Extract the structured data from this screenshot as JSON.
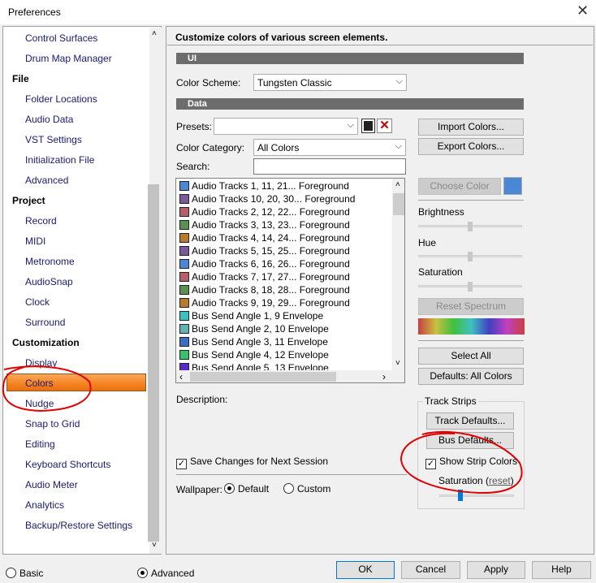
{
  "window": {
    "title": "Preferences",
    "close_icon": "close-icon"
  },
  "sidebar": {
    "items": [
      {
        "type": "item",
        "label": "Control Surfaces"
      },
      {
        "type": "item",
        "label": "Drum Map Manager"
      },
      {
        "type": "header",
        "label": "File"
      },
      {
        "type": "item",
        "label": "Folder Locations"
      },
      {
        "type": "item",
        "label": "Audio Data"
      },
      {
        "type": "item",
        "label": "VST Settings"
      },
      {
        "type": "item",
        "label": "Initialization File"
      },
      {
        "type": "item",
        "label": "Advanced"
      },
      {
        "type": "header",
        "label": "Project"
      },
      {
        "type": "item",
        "label": "Record"
      },
      {
        "type": "item",
        "label": "MIDI"
      },
      {
        "type": "item",
        "label": "Metronome"
      },
      {
        "type": "item",
        "label": "AudioSnap"
      },
      {
        "type": "item",
        "label": "Clock"
      },
      {
        "type": "item",
        "label": "Surround"
      },
      {
        "type": "header",
        "label": "Customization"
      },
      {
        "type": "item",
        "label": "Display"
      },
      {
        "type": "item",
        "label": "Colors",
        "selected": true
      },
      {
        "type": "item",
        "label": "Nudge"
      },
      {
        "type": "item",
        "label": "Snap to Grid"
      },
      {
        "type": "item",
        "label": "Editing"
      },
      {
        "type": "item",
        "label": "Keyboard Shortcuts"
      },
      {
        "type": "item",
        "label": "Audio Meter"
      },
      {
        "type": "item",
        "label": "Analytics"
      },
      {
        "type": "item",
        "label": "Backup/Restore Settings"
      }
    ]
  },
  "main": {
    "header": "Customize colors of various screen elements.",
    "ui_section": "UI",
    "color_scheme_label": "Color Scheme:",
    "color_scheme_value": "Tungsten Classic",
    "data_section": "Data",
    "presets_label": "Presets:",
    "presets_value": "",
    "color_category_label": "Color Category:",
    "color_category_value": "All Colors",
    "search_label": "Search:",
    "search_value": "",
    "list": [
      {
        "label": "Audio Tracks 1, 11, 21... Foreground",
        "color": "#4a88d6"
      },
      {
        "label": "Audio Tracks 10, 20, 30... Foreground",
        "color": "#7a5a9a"
      },
      {
        "label": "Audio Tracks 2, 12, 22... Foreground",
        "color": "#b85e6a"
      },
      {
        "label": "Audio Tracks 3, 13, 23... Foreground",
        "color": "#5a9050"
      },
      {
        "label": "Audio Tracks 4, 14, 24... Foreground",
        "color": "#b87a30"
      },
      {
        "label": "Audio Tracks 5, 15, 25... Foreground",
        "color": "#7a5a9a"
      },
      {
        "label": "Audio Tracks 6, 16, 26... Foreground",
        "color": "#4a88d6"
      },
      {
        "label": "Audio Tracks 7, 17, 27... Foreground",
        "color": "#b85e6a"
      },
      {
        "label": "Audio Tracks 8, 18, 28... Foreground",
        "color": "#5a9050"
      },
      {
        "label": "Audio Tracks 9, 19, 29... Foreground",
        "color": "#b87a30"
      },
      {
        "label": "Bus Send Angle 1, 9 Envelope",
        "color": "#3cc0c0"
      },
      {
        "label": "Bus Send Angle 2, 10 Envelope",
        "color": "#60b4b4"
      },
      {
        "label": "Bus Send Angle 3, 11 Envelope",
        "color": "#3a6ec0"
      },
      {
        "label": "Bus Send Angle 4, 12 Envelope",
        "color": "#3cc070"
      },
      {
        "label": "Bus Send Angle 5, 13 Envelope",
        "color": "#5a2ac8"
      }
    ],
    "import_colors": "Import Colors...",
    "export_colors": "Export Colors...",
    "choose_color": "Choose Color",
    "current_color": "#4a88d6",
    "brightness_label": "Brightness",
    "hue_label": "Hue",
    "saturation_label": "Saturation",
    "brightness_value": 50,
    "hue_value": 50,
    "saturation_value": 50,
    "reset_spectrum": "Reset Spectrum",
    "select_all": "Select All",
    "defaults_all": "Defaults: All Colors",
    "description_label": "Description:",
    "save_changes_label": "Save Changes for Next Session",
    "save_changes_checked": true,
    "wallpaper_label": "Wallpaper:",
    "wallpaper_default": "Default",
    "wallpaper_custom": "Custom",
    "wallpaper_selected": "Default",
    "track_strips": {
      "title": "Track Strips",
      "track_defaults": "Track Defaults...",
      "bus_defaults": "Bus Defaults...",
      "show_strip_colors": "Show Strip Colors",
      "show_strip_checked": true,
      "saturation_label": "Saturation (",
      "reset_link": "reset",
      "close_paren": ")",
      "saturation_value": 30
    }
  },
  "footer": {
    "basic": "Basic",
    "advanced": "Advanced",
    "mode_selected": "Advanced",
    "ok": "OK",
    "cancel": "Cancel",
    "apply": "Apply",
    "help": "Help"
  },
  "colors": {
    "selection": "#f58220",
    "annotation": "#e00000",
    "slider_accent": "#0078d7"
  }
}
